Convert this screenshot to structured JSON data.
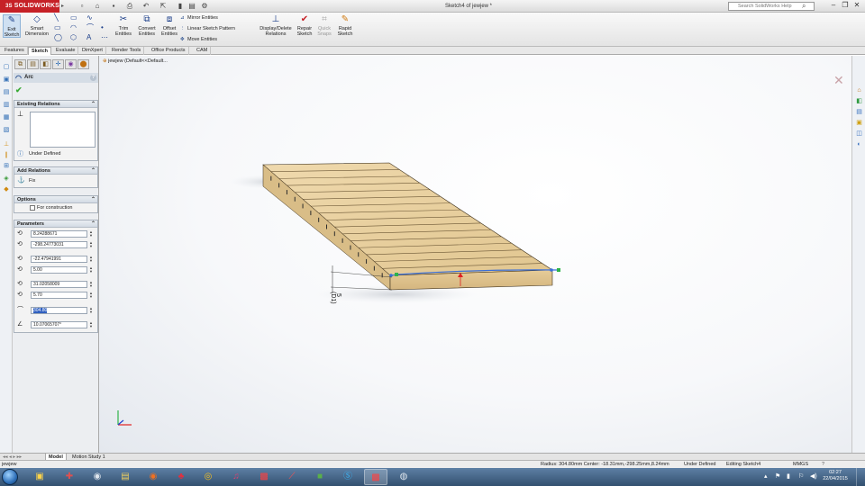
{
  "titlebar": {
    "brand_prefix": "3S",
    "brand": "SOLIDWORKS",
    "document_title": "Sketch4 of jewjew *",
    "search_placeholder": "Search SolidWorks Help"
  },
  "commands": {
    "exit_sketch": "Exit Sketch",
    "smart_dimension": "Smart Dimension",
    "trim_entities": "Trim Entities",
    "convert_entities": "Convert Entities",
    "offset_entities": "Offset Entities",
    "mirror_entities": "Mirror Entities",
    "linear_sketch_pattern": "Linear Sketch Pattern",
    "move_entities": "Move Entities",
    "display_delete_relations": "Display/Delete Relations",
    "repair_sketch": "Repair Sketch",
    "quick_snaps": "Quick Snaps",
    "rapid_sketch": "Rapid Sketch"
  },
  "tabs": [
    "Features",
    "Sketch",
    "Evaluate",
    "DimXpert",
    "Render Tools",
    "Office Products",
    "CAM"
  ],
  "active_tab": "Sketch",
  "property_manager": {
    "title": "Arc",
    "existing_relations": {
      "header": "Existing Relations",
      "status": "Under Defined"
    },
    "add_relations": {
      "header": "Add Relations",
      "items": [
        "Fix"
      ]
    },
    "options": {
      "header": "Options",
      "for_construction": "For construction"
    },
    "parameters": {
      "header": "Parameters",
      "values": [
        "8.24288671",
        "-298.24773031",
        "-22.47941991",
        "5.00",
        "31.02058009",
        "5.70",
        "304.80",
        "10.07065707°"
      ]
    }
  },
  "viewport": {
    "tree_root": "jewjew  (Default<<Default..."
  },
  "dimension": {
    "value": "5",
    "name": "(D1)"
  },
  "bottom_tabs": [
    "Model",
    "Motion Study 1"
  ],
  "active_bottom_tab": "Model",
  "status_bar": {
    "filename": "jewjew",
    "readout": "Radius: 304.80mm  Center: -18.31mm,-298.25mm,8.24mm",
    "definition": "Under Defined",
    "editing": "Editing Sketch4",
    "units": "MMGS"
  },
  "clock": {
    "time": "02:27",
    "date": "22/04/2015"
  },
  "colors": {
    "solidworks_red": "#c62127",
    "wood_top": "#e8cf9f",
    "wood_front": "#ddc08b",
    "sketch_blue": "#3a6fd8",
    "relation_green": "#2fb34a"
  }
}
